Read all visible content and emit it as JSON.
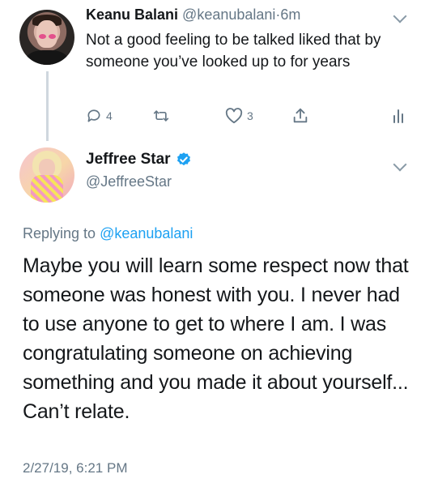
{
  "parent_tweet": {
    "display_name": "Keanu Balani",
    "handle": "@keanubalani",
    "separator": "·",
    "age": "6m",
    "text": "Not a good feeling to be talked liked that by someone you’ve looked up to for years",
    "actions": {
      "reply_count": "4",
      "retweet_count": "",
      "like_count": "3"
    },
    "icons": [
      "reply-icon",
      "retweet-icon",
      "like-icon",
      "share-icon",
      "analytics-icon",
      "chevron-down-icon"
    ]
  },
  "main_tweet": {
    "display_name": "Jeffree Star",
    "handle": "@JeffreeStar",
    "verified": true,
    "replying_prefix": "Replying to",
    "replying_to": "@keanubalani",
    "text": "Maybe you will learn some respect now that someone was honest with you. I never had to use anyone to get to where I am. I was congratulating someone on achieving something and you made it about yourself... Can’t relate.",
    "timestamp": "2/27/19, 6:21 PM"
  },
  "colors": {
    "text": "#14171a",
    "secondary": "#657786",
    "link": "#1da1f2",
    "thread_line": "#cfd7de",
    "verified": "#1da1f2"
  }
}
